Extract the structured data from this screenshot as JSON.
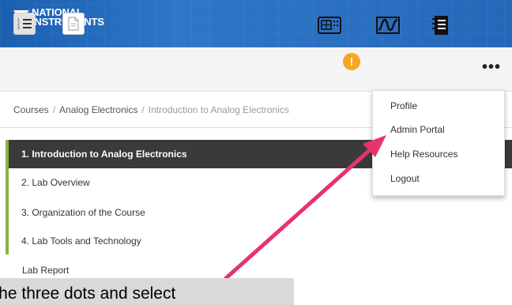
{
  "brand": {
    "line1": "NATIONAL",
    "line2": "INSTRUMENTS",
    "icon": "eagle-logo-icon",
    "color": "#2e76c6"
  },
  "toolbar": {
    "toc_icon": "numbered-list-icon",
    "doc_icon": "document-icon",
    "instrument_icon": "instrument-panel-icon",
    "notification_count": "!",
    "waveform_icon": "waveform-icon",
    "notebook_icon": "notebook-icon",
    "more_label": "•••"
  },
  "breadcrumb": {
    "items": [
      "Courses",
      "Analog Electronics",
      "Introduction to Analog Electronics"
    ],
    "separator": "/"
  },
  "nav": {
    "accent_color": "#86b440",
    "items": [
      {
        "label": "1. Introduction to Analog Electronics",
        "active": true
      },
      {
        "label": "2. Lab Overview",
        "active": false
      },
      {
        "label": "3. Organization of the Course",
        "active": false
      },
      {
        "label": "4. Lab Tools and Technology",
        "active": false
      },
      {
        "label": "Lab Report",
        "active": false
      }
    ]
  },
  "dropdown": {
    "items": [
      "Profile",
      "Admin Portal",
      "Help Resources",
      "Logout"
    ]
  },
  "callout": {
    "text": "k the three dots and select"
  },
  "colors": {
    "arrow": "#e8336b",
    "active_nav_bg": "#3a3a3a",
    "badge": "#f5a623"
  }
}
